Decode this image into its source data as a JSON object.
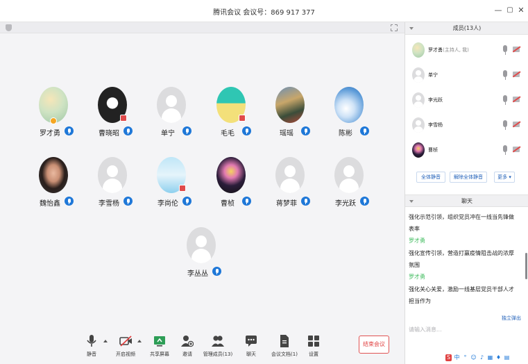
{
  "window": {
    "title": "腾讯会议  会议号：869 917 377"
  },
  "participants": [
    {
      "name": "罗才勇"
    },
    {
      "name": "曹晓昭"
    },
    {
      "name": "单宁"
    },
    {
      "name": "毛毛"
    },
    {
      "name": "瑶瑶"
    },
    {
      "name": "陈彬"
    },
    {
      "name": "魏怡鑫"
    },
    {
      "name": "李雪杨"
    },
    {
      "name": "李尚伦"
    },
    {
      "name": "曹桢"
    },
    {
      "name": "蒋梦菲"
    },
    {
      "name": "李光跃"
    },
    {
      "name": "李丛丛"
    }
  ],
  "toolbar": {
    "mute": "静音",
    "video": "开启视频",
    "share": "共享屏幕",
    "invite": "邀请",
    "manage": "管理成员(13)",
    "chat": "聊天",
    "docs": "会议文档(1)",
    "settings": "设置",
    "end": "结束会议"
  },
  "members_panel": {
    "header": "成员(13人)",
    "members": [
      {
        "name": "罗才勇",
        "role": "(主持人, 我)"
      },
      {
        "name": "单宁",
        "role": ""
      },
      {
        "name": "李光跃",
        "role": ""
      },
      {
        "name": "李雪杨",
        "role": ""
      },
      {
        "name": "曹桢",
        "role": ""
      }
    ],
    "mute_all": "全体静音",
    "unmute_all": "解除全体静音",
    "more": "更多 ▾"
  },
  "chat_panel": {
    "header": "聊天",
    "messages": [
      {
        "text": "强化示范引领，组织党员冲在一线当先锋做"
      },
      {
        "text": "表率"
      },
      {
        "sender": "罗才勇"
      },
      {
        "text": "强化宣传引领，营造打赢疫情阻击战的浓厚"
      },
      {
        "text": "氛围"
      },
      {
        "sender": "罗才勇"
      },
      {
        "text": "强化关心关爱，激励一线基层党员干部人才"
      },
      {
        "text": "担当作为"
      }
    ],
    "popout": "独立弹出",
    "input_placeholder": "请输入消息..."
  },
  "colors": {
    "accent": "#1f78d8",
    "end_red": "#e04040",
    "sender_green": "#3dbb5c"
  }
}
